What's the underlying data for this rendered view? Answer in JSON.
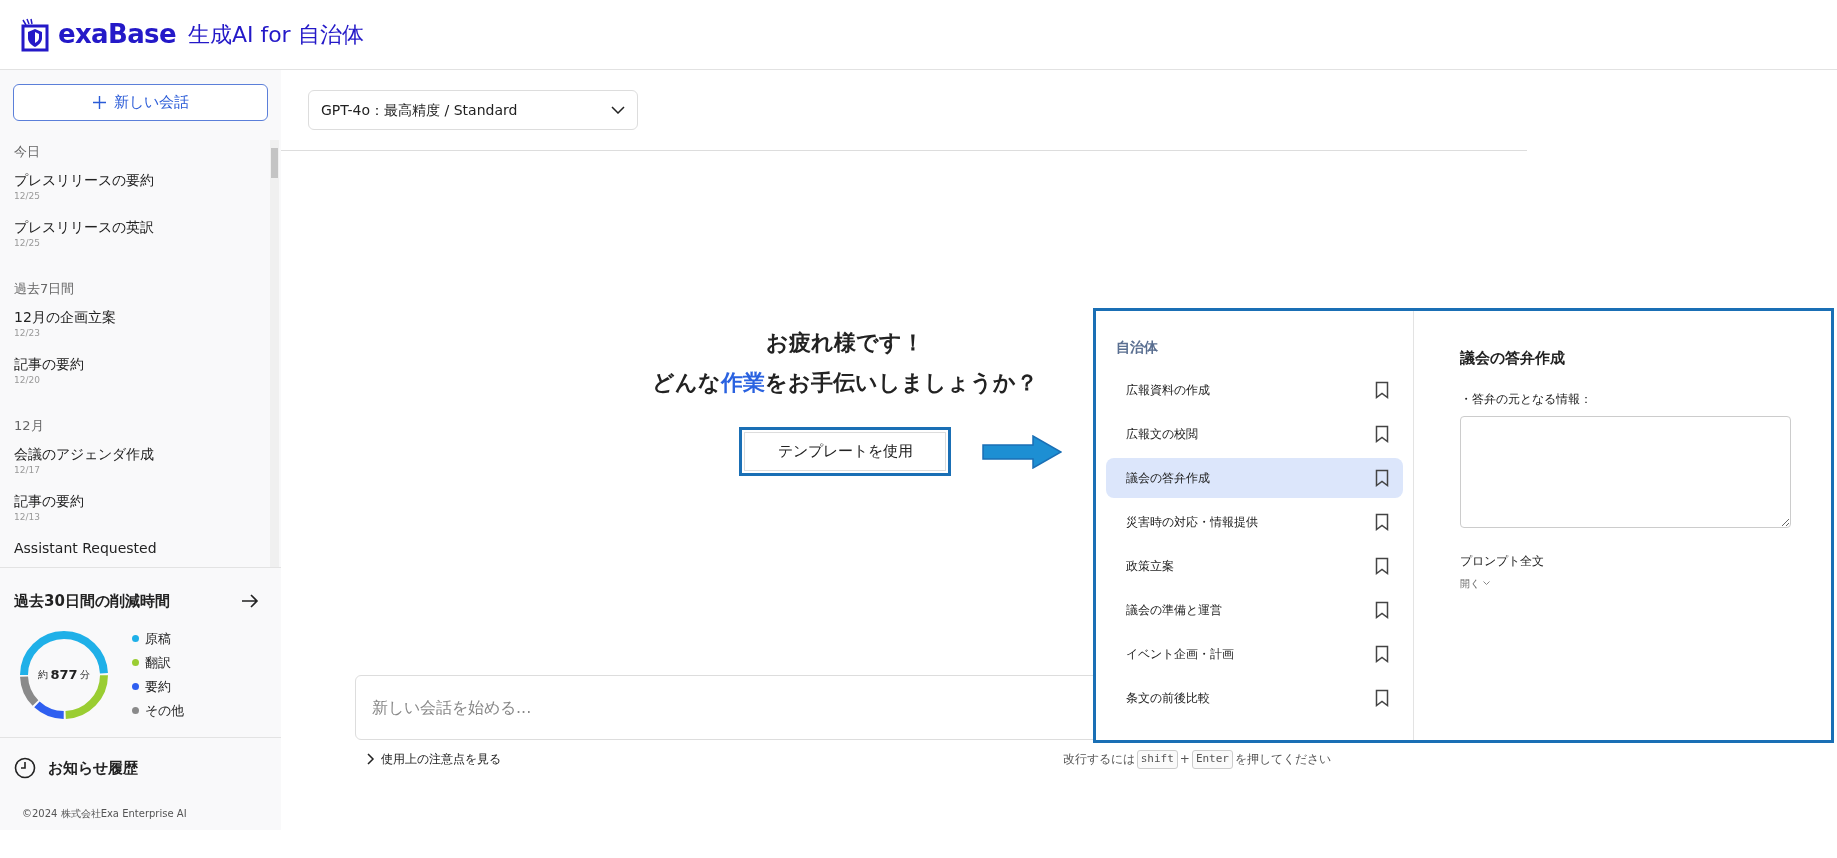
{
  "header": {
    "brand": "exaBase",
    "product": "生成AI for 自治体"
  },
  "sidebar": {
    "new_chat_button": "新しい会話",
    "history": [
      {
        "heading": "今日",
        "items": [
          {
            "title": "プレスリリースの要約",
            "date": "12/25"
          },
          {
            "title": "プレスリリースの英訳",
            "date": "12/25"
          }
        ]
      },
      {
        "heading": "過去7日間",
        "items": [
          {
            "title": "12月の企画立案",
            "date": "12/23"
          },
          {
            "title": "記事の要約",
            "date": "12/20"
          }
        ]
      },
      {
        "heading": "12月",
        "items": [
          {
            "title": "会議のアジェンダ作成",
            "date": "12/17"
          },
          {
            "title": "記事の要約",
            "date": "12/13"
          },
          {
            "title": "Assistant Requested"
          }
        ]
      }
    ],
    "savings": {
      "title": "過去30日間の削減時間",
      "prefix": "約",
      "value": "877",
      "unit": "分",
      "legend": [
        {
          "label": "原稿",
          "color": "#1fb0e8"
        },
        {
          "label": "翻訳",
          "color": "#9acd32"
        },
        {
          "label": "要約",
          "color": "#2f5ff0"
        },
        {
          "label": "その他",
          "color": "#8a8a8a"
        }
      ]
    },
    "notifications": "お知らせ履歴",
    "copyright": "©2024 株式会社Exa Enterprise AI"
  },
  "model_select": {
    "value": "GPT-4o：最高精度 / Standard"
  },
  "greeting": {
    "line1": "お疲れ様です！",
    "line2_before": "どんな",
    "line2_highlight": "作業",
    "line2_after": "をお手伝いしましょうか？"
  },
  "template_button": "テンプレートを使用",
  "composer": {
    "placeholder": "新しい会話を始める...",
    "notes_link": "使用上の注意点を見る",
    "hint": {
      "before": "改行するには",
      "keys": [
        "shift",
        "Enter"
      ],
      "separator": "+",
      "after": "を押してください"
    }
  },
  "template_panel": {
    "category": "自治体",
    "templates": [
      {
        "label": "広報資料の作成",
        "selected": false
      },
      {
        "label": "広報文の校閲",
        "selected": false
      },
      {
        "label": "議会の答弁作成",
        "selected": true
      },
      {
        "label": "災害時の対応・情報提供",
        "selected": false
      },
      {
        "label": "政策立案",
        "selected": false
      },
      {
        "label": "議会の準備と運営",
        "selected": false
      },
      {
        "label": "イベント企画・計画",
        "selected": false
      },
      {
        "label": "条文の前後比較",
        "selected": false
      }
    ],
    "detail": {
      "title": "議会の答弁作成",
      "field_label": "・答弁の元となる情報：",
      "prompt_label": "プロンプト全文",
      "expand": "開く"
    }
  }
}
